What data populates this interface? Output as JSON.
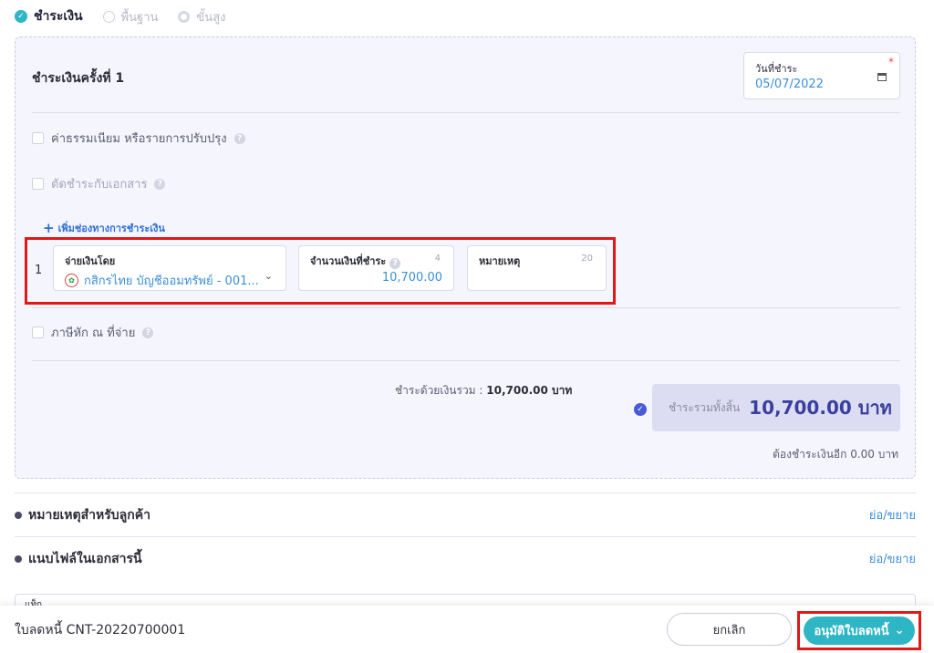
{
  "modes": {
    "active": "ชำระเงิน",
    "basic": "พื้นฐาน",
    "advanced": "ขั้นสูง"
  },
  "payment": {
    "title": "ชำระเงินครั้งที่ 1",
    "date_label": "วันที่ชำระ",
    "date_required": "*",
    "date_value": "05/07/2022",
    "fee_label": "ค่าธรรมเนียม หรือรายการปรับปรุง",
    "offset_label": "ตัดชำระกับเอกสาร",
    "add_channel": "เพิ่มช่องทางการชำระเงิน",
    "row_index": "1",
    "method_label": "จ่ายเงินโดย",
    "method_value": "กสิกรไทย บัญชีออมทรัพย์ - 001...",
    "amount_label": "จำนวนเงินที่ชำระ",
    "amount_count": "4",
    "amount_value": "10,700.00",
    "note_label": "หมายเหตุ",
    "note_count": "20",
    "withholding_label": "ภาษีหัก ณ ที่จ่าย",
    "summary_label": "ชำระด้วยเงินรวม :",
    "summary_value": "10,700.00 บาท",
    "total_label": "ชำระรวมทั้งสิ้น",
    "total_value": "10,700.00 บาท",
    "remaining": "ต้องชำระเงินอีก 0.00 บาท"
  },
  "sections": [
    {
      "title": "หมายเหตุสำหรับลูกค้า",
      "toggle": "ย่อ/ขยาย"
    },
    {
      "title": "แนบไฟล์ในเอกสารนี้",
      "toggle": "ย่อ/ขยาย"
    }
  ],
  "peek_text": "แท็ก",
  "footer": {
    "doc_number": "ใบลดหนี้ CNT-20220700001",
    "cancel": "ยกเลิก",
    "approve": "อนุมัติใบลดหนี้"
  },
  "colors": {
    "accent": "#2fb6c4",
    "link": "#3a8fd9",
    "highlight": "#e01818"
  },
  "icons": {
    "check": "✓",
    "help": "?",
    "plus": "+",
    "chevron": "⌄"
  }
}
